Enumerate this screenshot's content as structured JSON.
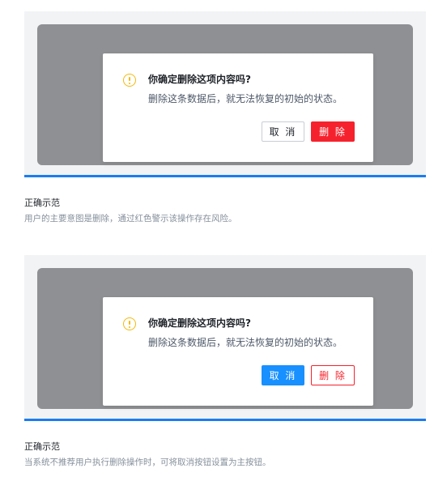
{
  "examples": [
    {
      "dialog": {
        "title": "你确定删除这项内容吗?",
        "description": "删除这条数据后，就无法恢复的初始的状态。",
        "cancel_label": "取 消",
        "delete_label": "删 除"
      },
      "caption": {
        "title": "正确示范",
        "description": "用户的主要意图是删除，通过红色警示该操作存在风险。"
      }
    },
    {
      "dialog": {
        "title": "你确定删除这项内容吗?",
        "description": "删除这条数据后，就无法恢复的初始的状态。",
        "cancel_label": "取 消",
        "delete_label": "删 除"
      },
      "caption": {
        "title": "正确示范",
        "description": "当系统不推荐用户执行删除操作时，可将取消按钮设置为主按钮。"
      }
    }
  ],
  "colors": {
    "accent_divider": "#1b7cf2",
    "danger": "#f5222d",
    "primary": "#1890ff",
    "warning": "#f5b90b",
    "overlay": "#8f9093"
  },
  "icons": {
    "dialog_icon": "exclamation-circle-icon"
  }
}
